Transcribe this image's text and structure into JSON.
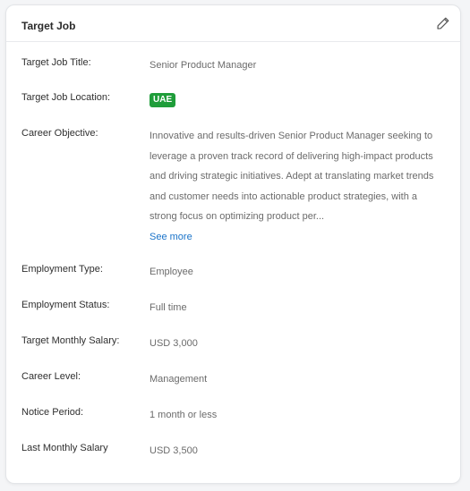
{
  "card": {
    "title": "Target Job",
    "edit_icon": "pencil-icon"
  },
  "fields": {
    "job_title": {
      "label": "Target Job Title:",
      "value": "Senior Product Manager"
    },
    "job_location": {
      "label": "Target Job Location:",
      "value": "UAE",
      "badge_color": "#1f9d3a"
    },
    "career_objective": {
      "label": "Career Objective:",
      "value": "Innovative and results-driven Senior Product Manager seeking to leverage a proven track record of delivering high-impact products and driving strategic initiatives. Adept at translating market trends and customer needs into actionable product strategies, with a strong focus on optimizing product per...",
      "see_more": "See more",
      "link_color": "#1a73c9"
    },
    "employment_type": {
      "label": "Employment Type:",
      "value": "Employee"
    },
    "employment_status": {
      "label": "Employment Status:",
      "value": "Full time"
    },
    "target_salary": {
      "label": "Target Monthly Salary:",
      "value": "USD 3,000"
    },
    "career_level": {
      "label": "Career Level:",
      "value": "Management"
    },
    "notice_period": {
      "label": "Notice Period:",
      "value": "1 month or less"
    },
    "last_salary": {
      "label": "Last Monthly Salary",
      "value": "USD 3,500"
    }
  }
}
